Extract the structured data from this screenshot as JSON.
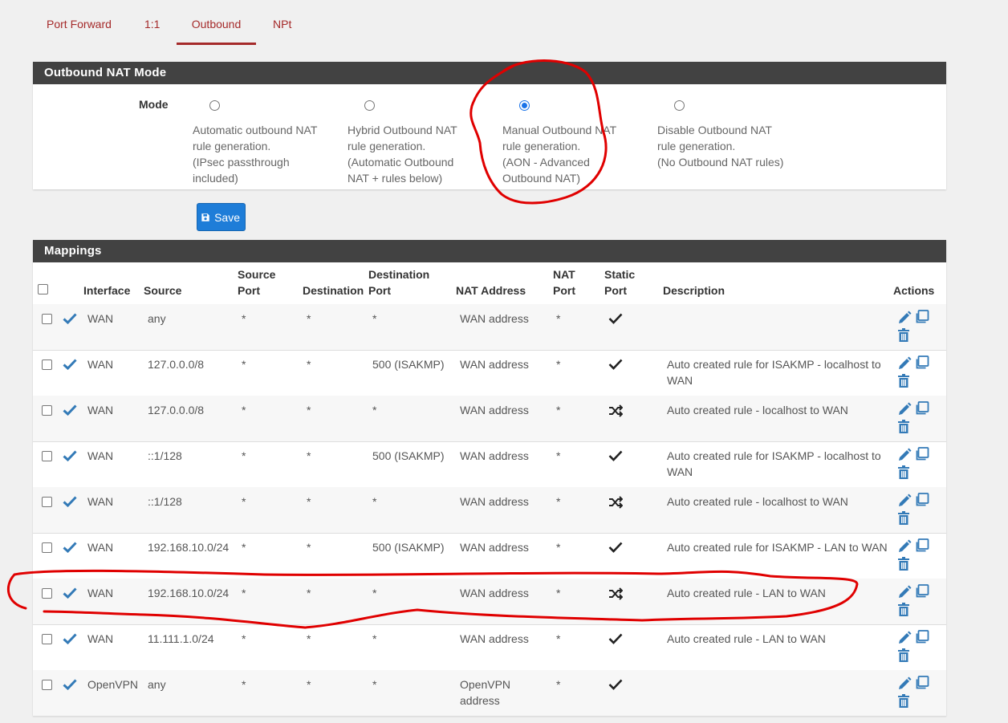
{
  "tabs": [
    {
      "label": "Port Forward"
    },
    {
      "label": "1:1"
    },
    {
      "label": "Outbound"
    },
    {
      "label": "NPt"
    }
  ],
  "active_tab": "Outbound",
  "mode_panel": {
    "title": "Outbound NAT Mode",
    "mode_label": "Mode",
    "options": [
      {
        "lines": [
          "Automatic outbound NAT",
          "rule generation.",
          "(IPsec passthrough",
          "included)"
        ],
        "checked": false
      },
      {
        "lines": [
          "Hybrid Outbound NAT",
          "rule generation.",
          "(Automatic Outbound",
          "NAT + rules below)"
        ],
        "checked": false
      },
      {
        "lines": [
          "Manual Outbound NAT",
          "rule generation.",
          "(AON - Advanced",
          "Outbound NAT)"
        ],
        "checked": true
      },
      {
        "lines": [
          "Disable Outbound NAT",
          "rule generation.",
          "(No Outbound NAT rules)"
        ],
        "checked": false
      }
    ]
  },
  "save_button": {
    "label": "Save"
  },
  "mappings": {
    "title": "Mappings",
    "headers": {
      "interface": "Interface",
      "source": "Source",
      "source_port_1": "Source",
      "source_port_2": "Port",
      "destination": "Destination",
      "dest_port_1": "Destination",
      "dest_port_2": "Port",
      "nat_address": "NAT Address",
      "nat_port_1": "NAT",
      "nat_port_2": "Port",
      "static_port_1": "Static",
      "static_port_2": "Port",
      "description": "Description",
      "actions": "Actions"
    },
    "rows": [
      {
        "interface": "WAN",
        "source": "any",
        "source_port": "*",
        "destination": "*",
        "dest_port": "*",
        "nat_address": [
          "WAN address"
        ],
        "nat_port": "*",
        "static": "check",
        "description": [
          "",
          ""
        ]
      },
      {
        "interface": "WAN",
        "source": "127.0.0.0/8",
        "source_port": "*",
        "destination": "*",
        "dest_port": "500 (ISAKMP)",
        "nat_address": [
          "WAN address"
        ],
        "nat_port": "*",
        "static": "check",
        "description": [
          "Auto created rule for ISAKMP - localhost to",
          "WAN"
        ]
      },
      {
        "interface": "WAN",
        "source": "127.0.0.0/8",
        "source_port": "*",
        "destination": "*",
        "dest_port": "*",
        "nat_address": [
          "WAN address"
        ],
        "nat_port": "*",
        "static": "shuffle",
        "description": [
          "Auto created rule - localhost to WAN",
          ""
        ]
      },
      {
        "interface": "WAN",
        "source": "::1/128",
        "source_port": "*",
        "destination": "*",
        "dest_port": "500 (ISAKMP)",
        "nat_address": [
          "WAN address"
        ],
        "nat_port": "*",
        "static": "check",
        "description": [
          "Auto created rule for ISAKMP - localhost to",
          "WAN"
        ]
      },
      {
        "interface": "WAN",
        "source": "::1/128",
        "source_port": "*",
        "destination": "*",
        "dest_port": "*",
        "nat_address": [
          "WAN address"
        ],
        "nat_port": "*",
        "static": "shuffle",
        "description": [
          "Auto created rule - localhost to WAN",
          ""
        ]
      },
      {
        "interface": "WAN",
        "source": "192.168.10.0/24",
        "source_port": "*",
        "destination": "*",
        "dest_port": "500 (ISAKMP)",
        "nat_address": [
          "WAN address"
        ],
        "nat_port": "*",
        "static": "check",
        "description": [
          "Auto created rule for ISAKMP - LAN to WAN",
          ""
        ]
      },
      {
        "interface": "WAN",
        "source": "192.168.10.0/24",
        "source_port": "*",
        "destination": "*",
        "dest_port": "*",
        "nat_address": [
          "WAN address"
        ],
        "nat_port": "*",
        "static": "shuffle",
        "description": [
          "Auto created rule - LAN to WAN",
          ""
        ]
      },
      {
        "interface": "WAN",
        "source": "11.111.1.0/24",
        "source_port": "*",
        "destination": "*",
        "dest_port": "*",
        "nat_address": [
          "WAN address"
        ],
        "nat_port": "*",
        "static": "check",
        "description": [
          "Auto created rule - LAN to WAN",
          ""
        ]
      },
      {
        "interface": "OpenVPN",
        "source": "any",
        "source_port": "*",
        "destination": "*",
        "dest_port": "*",
        "nat_address": [
          "OpenVPN",
          "address"
        ],
        "nat_port": "*",
        "static": "check",
        "description": [
          "",
          ""
        ]
      }
    ]
  },
  "colors": {
    "tab_text": "#a52a2a",
    "panel_heading_bg": "#424242",
    "primary_button": "#1e7dd8",
    "enabled_check": "#337ab7",
    "action_icon": "#337ab7",
    "annotation_stroke": "#e00000"
  }
}
